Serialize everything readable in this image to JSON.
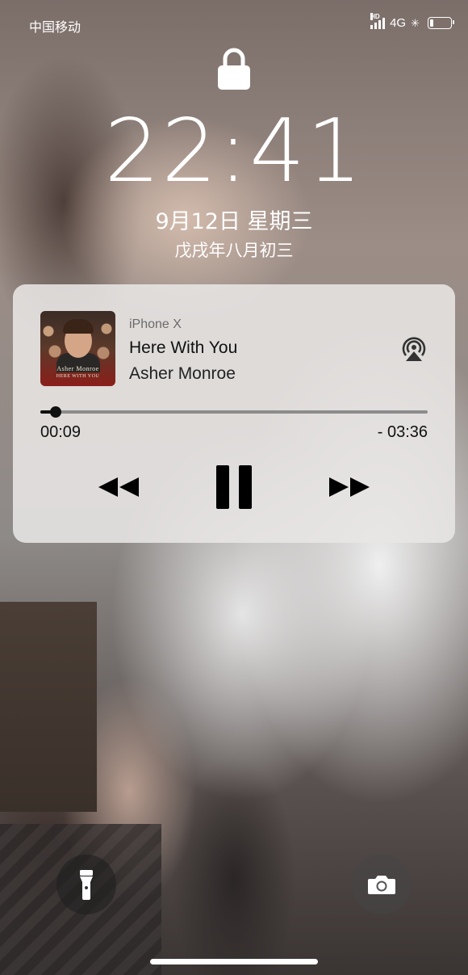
{
  "status_bar": {
    "carrier": "中国移动",
    "hd_label": "HD",
    "network": "4G",
    "battery_level_fraction": 0.2
  },
  "lock_screen": {
    "time": "22:41",
    "date": "9月12日  星期三",
    "lunar_date": "戊戌年八月初三"
  },
  "media_player": {
    "device": "iPhone X",
    "song_title": "Here With You",
    "artist": "Asher Monroe",
    "album_art_text_line1": "Asher Monroe",
    "album_art_text_line2": "HERE WITH YOU",
    "elapsed": "00:09",
    "remaining": "- 03:36",
    "progress_fraction": 0.04
  },
  "icons": {
    "lock": "lock-icon",
    "airplay": "airplay-icon",
    "rewind": "rewind-icon",
    "pause": "pause-icon",
    "forward": "fast-forward-icon",
    "flashlight": "flashlight-icon",
    "camera": "camera-icon"
  }
}
